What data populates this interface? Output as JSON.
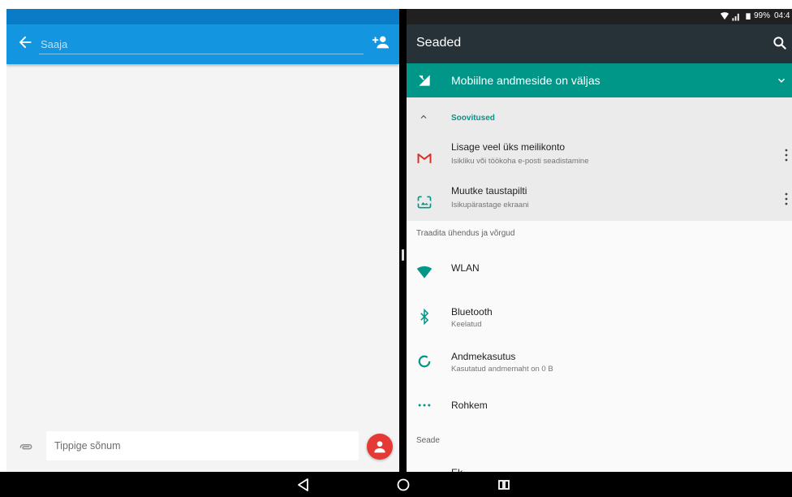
{
  "left": {
    "recipient_placeholder": "Saaja",
    "compose_placeholder": "Tippige sõnum",
    "colors": {
      "appbar": "#1495e0",
      "statusbar": "#0a7bc7",
      "fab": "#e53935"
    },
    "icons": [
      "back-arrow-icon",
      "add-contact-icon",
      "attach-icon",
      "person-icon"
    ]
  },
  "right": {
    "status": {
      "battery": "99%",
      "time": "04:4"
    },
    "toolbar_title": "Seaded",
    "banner": "Mobiilne andmeside on väljas",
    "suggestions": {
      "title": "Soovitused",
      "items": [
        {
          "title": "Lisage veel üks meilikonto",
          "subtitle": "Isikliku või töökoha e-posti seadistamine",
          "icon": "gmail-icon"
        },
        {
          "title": "Muutke taustapilti",
          "subtitle": "Isikupärastage ekraani",
          "icon": "wallpaper-icon"
        }
      ]
    },
    "sections": [
      {
        "header": "Traadita ühendus ja võrgud",
        "items": [
          {
            "title": "WLAN",
            "subtitle": "",
            "icon": "wifi-icon"
          },
          {
            "title": "Bluetooth",
            "subtitle": "Keelatud",
            "icon": "bluetooth-icon"
          },
          {
            "title": "Andmekasutus",
            "subtitle": "Kasutatud andmemaht on 0 B",
            "icon": "data-usage-icon"
          },
          {
            "title": "Rohkem",
            "subtitle": "",
            "icon": "more-dots-icon"
          }
        ]
      },
      {
        "header": "Seade",
        "items": [
          {
            "title": "Ek",
            "icon": "display-icon"
          }
        ]
      }
    ],
    "colors": {
      "accent": "#009688",
      "toolbar": "#263238"
    }
  },
  "nav": {
    "icons": [
      "back-triangle-icon",
      "home-circle-icon",
      "recents-icon"
    ]
  }
}
